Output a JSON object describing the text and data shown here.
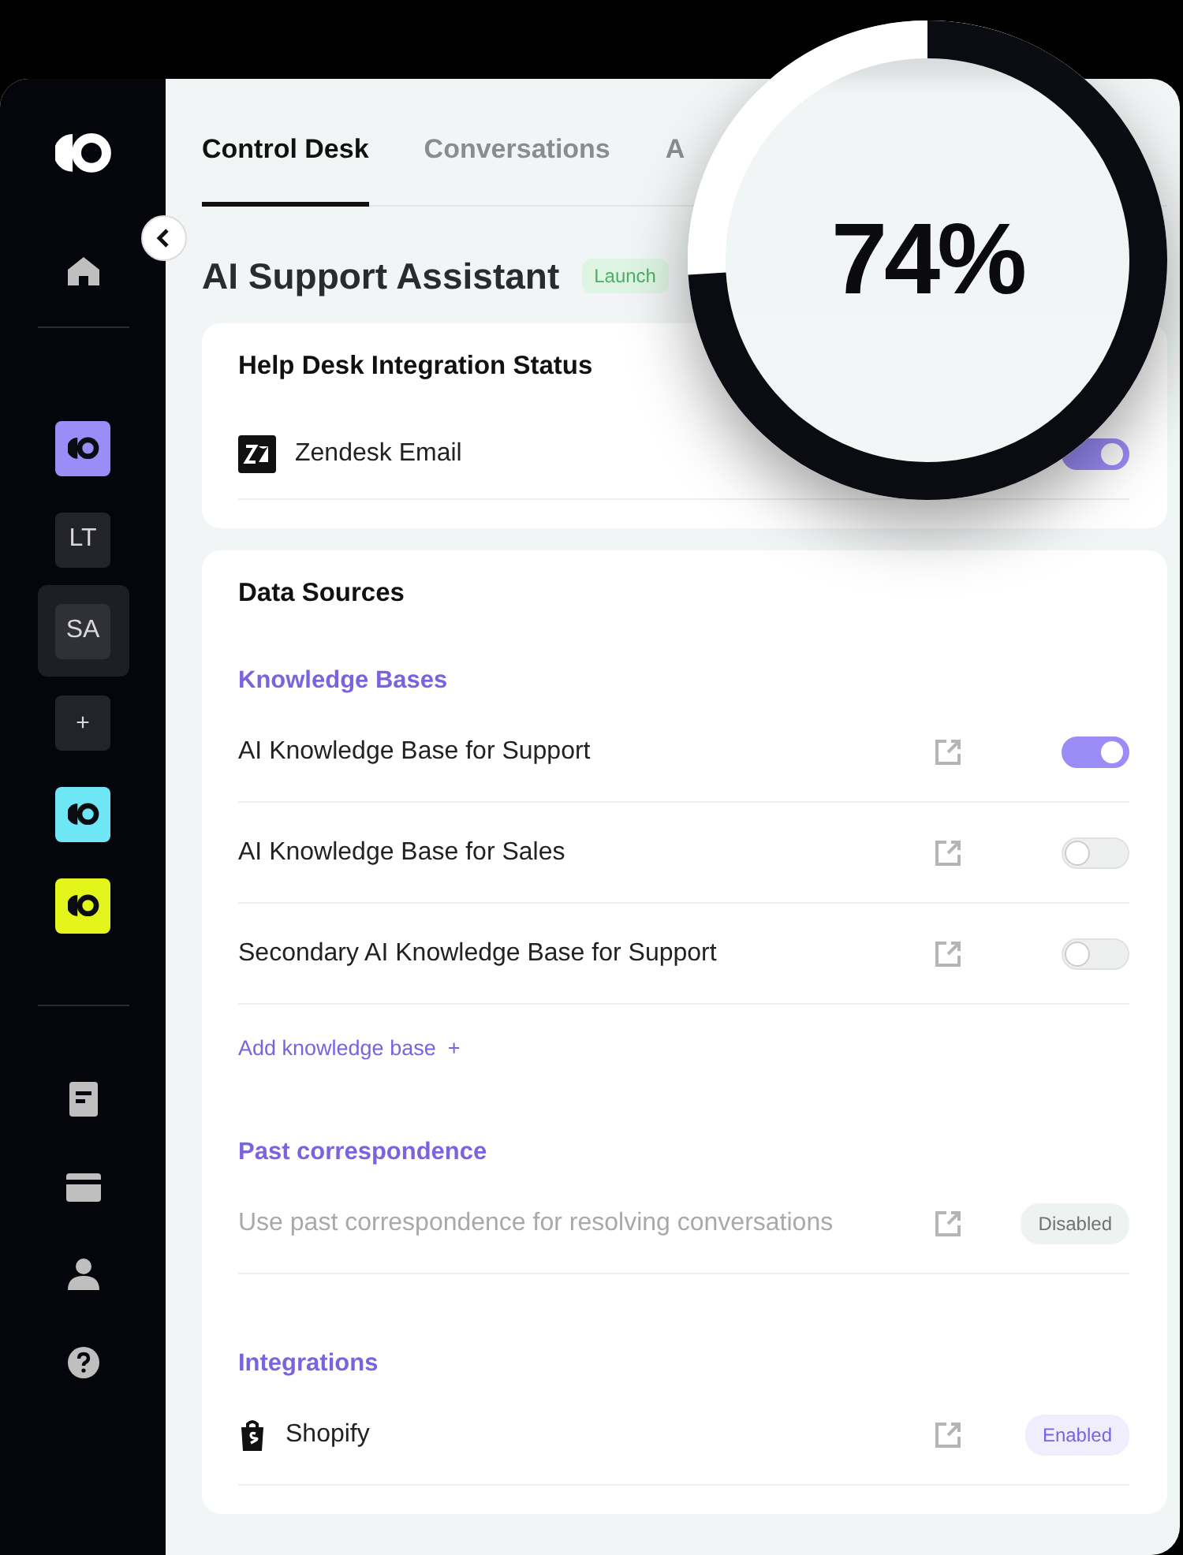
{
  "sidebar": {
    "workspaces": [
      {
        "kind": "logo",
        "color": "#9b8cf7",
        "selected": false
      },
      {
        "kind": "initials",
        "label": "LT",
        "selected": false
      },
      {
        "kind": "initials",
        "label": "SA",
        "selected": true
      },
      {
        "kind": "add",
        "label": "+",
        "selected": false
      },
      {
        "kind": "logo",
        "color": "#6ee6f5",
        "selected": false
      },
      {
        "kind": "logo",
        "color": "#e4f51c",
        "selected": false
      }
    ]
  },
  "tabs": [
    {
      "label": "Control Desk",
      "selected": true
    },
    {
      "label": "Conversations",
      "selected": false
    },
    {
      "label": "A",
      "selected": false
    }
  ],
  "page_title": "AI Support Assistant",
  "status_badge": "Launch",
  "progress": {
    "label": "74%",
    "level": 0.74
  },
  "help_desk": {
    "title": "Help Desk Integration Status",
    "rows": [
      {
        "name": "Zendesk Email",
        "on": true
      }
    ]
  },
  "data_sources": {
    "title": "Data Sources",
    "sections": [
      {
        "heading": "Knowledge Bases",
        "rows": [
          {
            "kind": "toggle",
            "name": "AI Knowledge Base for Support",
            "on": true
          },
          {
            "kind": "toggle",
            "name": "AI Knowledge Base for Sales",
            "on": false
          },
          {
            "kind": "toggle",
            "name": "Secondary AI Knowledge Base for Support",
            "on": false
          }
        ],
        "add_link": "Add knowledge base  +"
      },
      {
        "heading": "Past correspondence",
        "rows": [
          {
            "kind": "status",
            "name": "Use past correspondence for resolving conversations",
            "disabled": true,
            "status": "Disabled",
            "enabled": false
          }
        ]
      },
      {
        "heading": "Integrations",
        "rows": [
          {
            "kind": "status",
            "name": "Shopify",
            "disabled": false,
            "status": "Enabled",
            "enabled": true
          }
        ]
      }
    ]
  }
}
